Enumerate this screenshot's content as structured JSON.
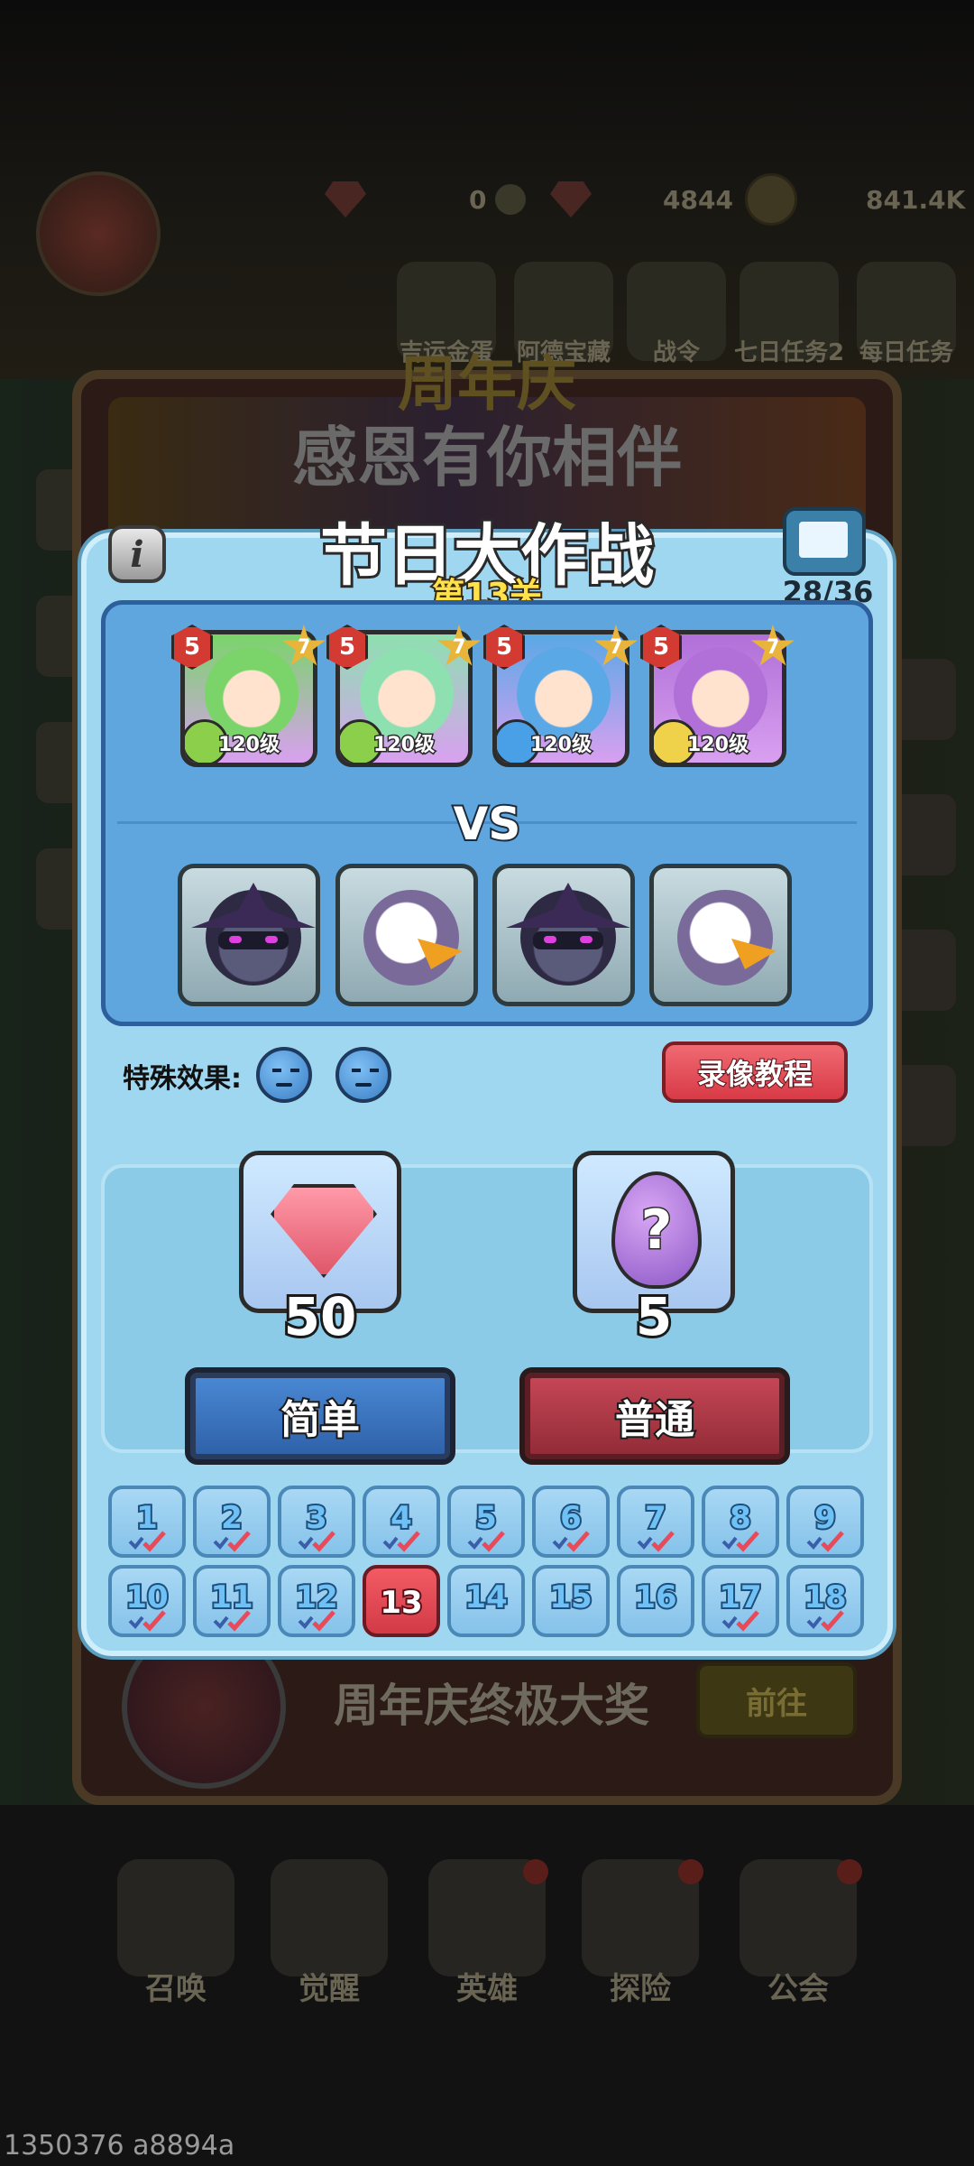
{
  "top_bar": {
    "resources": [
      "0",
      "4844",
      "841.4K"
    ],
    "menu_labels": [
      "吉运金蛋",
      "阿德宝藏",
      "战令",
      "七日任务2",
      "每日任务"
    ]
  },
  "event_bg": {
    "title_line1": "周年庆",
    "title_line2": "感恩有你相伴",
    "grand_prize": "周年庆终极大奖",
    "go_button": "前往"
  },
  "dialog": {
    "title": "节日大作战",
    "stage": "第13关",
    "progress": "28/36",
    "info_icon": "i",
    "vs": "VS",
    "heroes": [
      {
        "rank": "5",
        "star": "7",
        "level": "120级",
        "element": "wind",
        "color": "#7ad46a"
      },
      {
        "rank": "5",
        "star": "7",
        "level": "120级",
        "element": "wind",
        "color": "#8ee0b0"
      },
      {
        "rank": "5",
        "star": "7",
        "level": "120级",
        "element": "water",
        "color": "#5aa8e6"
      },
      {
        "rank": "5",
        "star": "7",
        "level": "120级",
        "element": "light",
        "color": "#b070d8"
      }
    ],
    "enemies": [
      {
        "type": "ninja"
      },
      {
        "type": "eagle"
      },
      {
        "type": "ninja"
      },
      {
        "type": "eagle"
      }
    ],
    "special_effect_label": "特殊效果:",
    "replay_button": "录像教程",
    "rewards": [
      {
        "icon": "gem-icon",
        "count": "50"
      },
      {
        "icon": "mystery-egg-icon",
        "count": "5",
        "glyph": "?"
      }
    ],
    "modes": {
      "easy": "简单",
      "normal": "普通"
    },
    "levels": [
      {
        "n": "1",
        "done": true
      },
      {
        "n": "2",
        "done": true
      },
      {
        "n": "3",
        "done": true
      },
      {
        "n": "4",
        "done": true
      },
      {
        "n": "5",
        "done": true
      },
      {
        "n": "6",
        "done": true
      },
      {
        "n": "7",
        "done": true
      },
      {
        "n": "8",
        "done": true
      },
      {
        "n": "9",
        "done": true
      },
      {
        "n": "10",
        "done": true
      },
      {
        "n": "11",
        "done": true
      },
      {
        "n": "12",
        "done": true
      },
      {
        "n": "13",
        "done": false,
        "current": true
      },
      {
        "n": "14",
        "done": false
      },
      {
        "n": "15",
        "done": false
      },
      {
        "n": "16",
        "done": false
      },
      {
        "n": "17",
        "done": true
      },
      {
        "n": "18",
        "done": true
      }
    ]
  },
  "bottom_nav": [
    "召唤",
    "觉醒",
    "英雄",
    "探险",
    "公会"
  ],
  "watermark": "1350376 a8894a"
}
